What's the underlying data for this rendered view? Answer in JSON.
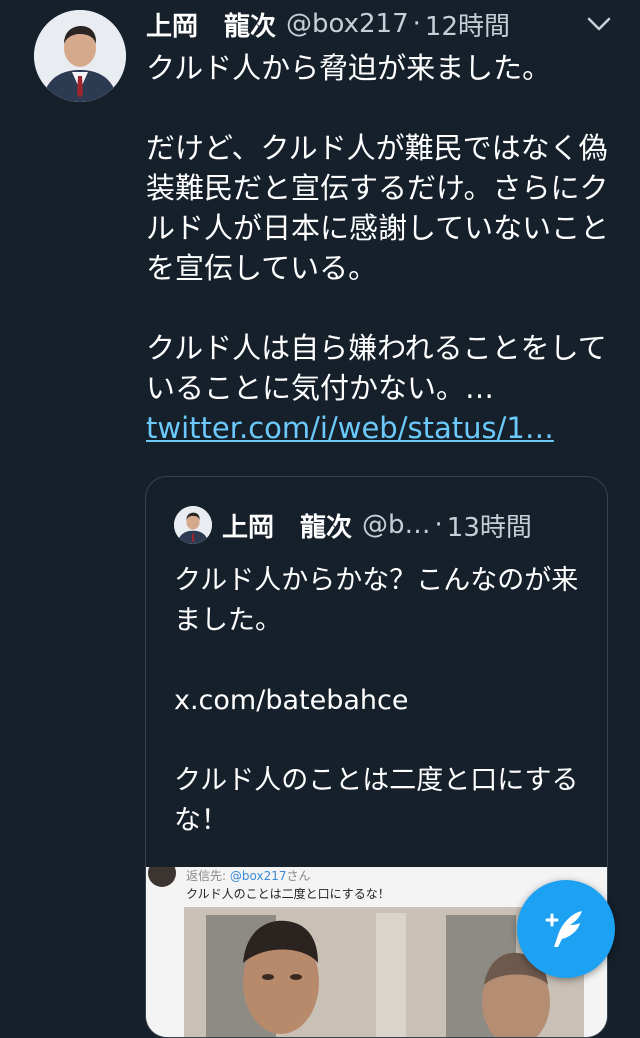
{
  "tweet": {
    "display_name": "上岡　龍次",
    "handle": "@box217",
    "separator": "·",
    "time": "12時間",
    "text_paragraph_1": "クルド人から脅迫が来ました。",
    "text_paragraph_2": "だけど、クルド人が難民ではなく偽装難民だと宣伝するだけ。さらにクルド人が日本に感謝していないことを宣伝している。",
    "text_paragraph_3": "クルド人は自ら嫌われることをしていることに気付かない。…",
    "link": "twitter.com/i/web/status/1…",
    "avatar_icon": "profile-photo",
    "menu_icon": "chevron-down-icon"
  },
  "quoted_tweet": {
    "display_name": "上岡　龍次",
    "handle": "@b…",
    "separator": "·",
    "time": "13時間",
    "text_paragraph_1": "クルド人からかな？こんなのが来ました。",
    "text_paragraph_2": "x.com/batebahce",
    "text_paragraph_3": "クルド人のことは二度と口にするな！",
    "image": {
      "reply_prefix": "返信先:",
      "reply_mention": "@box217",
      "reply_suffix": "さん",
      "caption": "クルド人のことは二度と口にするな！"
    }
  },
  "compose_button": {
    "icon": "compose-quill-icon"
  },
  "colors": {
    "background": "#15202b",
    "link": "#6bc9fb",
    "accent": "#1da1f2",
    "secondary_text": "#c4cfd6",
    "border": "#38444d"
  }
}
